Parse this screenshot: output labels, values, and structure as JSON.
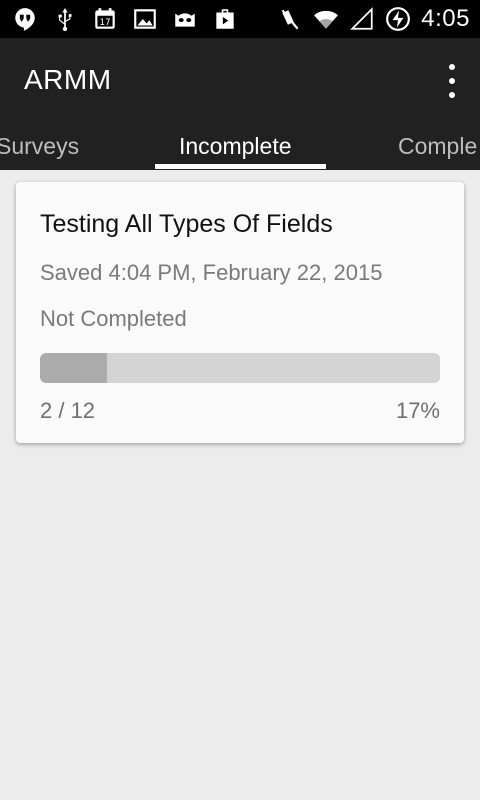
{
  "status_bar": {
    "time": "4:05",
    "left_icons": [
      "hangouts-icon",
      "usb-icon",
      "calendar-17-icon",
      "image-icon",
      "cyanogen-icon",
      "play-store-icon"
    ],
    "right_icons": [
      "mute-icon",
      "wifi-icon",
      "no-signal-icon",
      "battery-charging-icon"
    ],
    "calendar_day": "17"
  },
  "app_bar": {
    "title": "ARMM"
  },
  "tabs": [
    {
      "label": "Surveys",
      "active": false
    },
    {
      "label": "Incomplete",
      "active": true
    },
    {
      "label": "Comple",
      "active": false
    }
  ],
  "survey_card": {
    "title": "Testing All Types Of Fields",
    "saved": "Saved 4:04 PM, February 22, 2015",
    "status": "Not Completed",
    "progress_fraction": 0.167,
    "progress_count": "2 / 12",
    "progress_percent": "17%"
  },
  "colors": {
    "app_bar": "#212121",
    "background": "#ececec",
    "progress_track": "#d4d4d4",
    "progress_fill": "#ababab"
  }
}
